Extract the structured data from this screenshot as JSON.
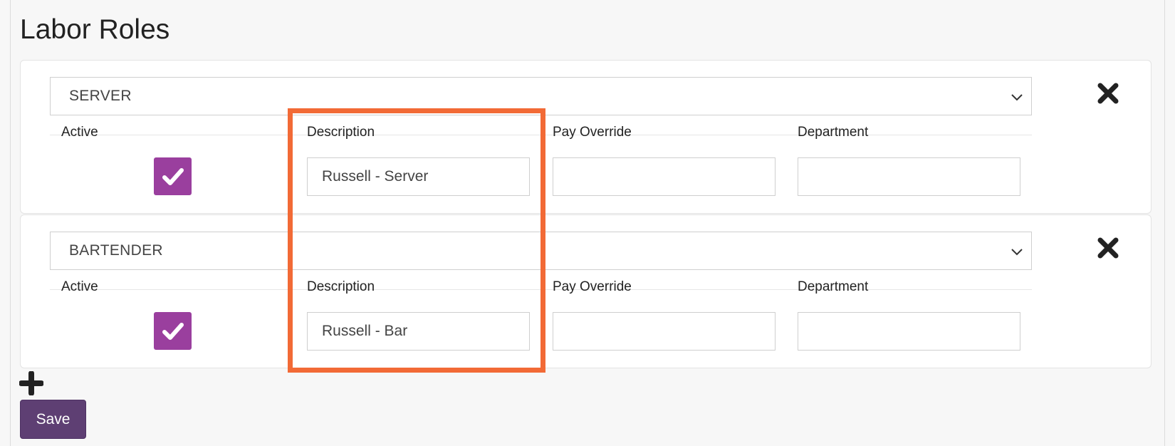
{
  "page": {
    "title": "Labor Roles"
  },
  "roles": [
    {
      "role_name": "SERVER",
      "active_label": "Active",
      "active_checked": true,
      "description_label": "Description",
      "description_value": "Russell - Server",
      "pay_override_label": "Pay Override",
      "pay_override_value": "",
      "department_label": "Department",
      "department_value": ""
    },
    {
      "role_name": "BARTENDER",
      "active_label": "Active",
      "active_checked": true,
      "description_label": "Description",
      "description_value": "Russell - Bar",
      "pay_override_label": "Pay Override",
      "pay_override_value": "",
      "department_label": "Department",
      "department_value": ""
    }
  ],
  "actions": {
    "save_label": "Save",
    "add_icon": "plus-icon",
    "remove_icon": "close-icon"
  },
  "colors": {
    "checkbox": "#9a3f9e",
    "save_button": "#5e3f73",
    "highlight": "#f26a36"
  }
}
